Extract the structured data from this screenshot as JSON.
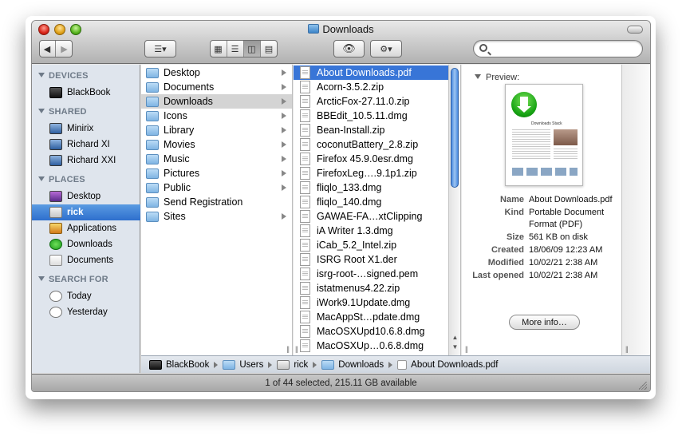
{
  "window": {
    "title": "Downloads"
  },
  "sidebar": {
    "devices_header": "DEVICES",
    "devices": [
      {
        "label": "BlackBook",
        "icon": "laptop-icon"
      }
    ],
    "shared_header": "SHARED",
    "shared": [
      {
        "label": "Minirix",
        "icon": "monitor-icon"
      },
      {
        "label": "Richard XI",
        "icon": "monitor-icon"
      },
      {
        "label": "Richard XXI",
        "icon": "monitor-icon"
      }
    ],
    "places_header": "PLACES",
    "places": [
      {
        "label": "Desktop",
        "icon": "desktop-icon"
      },
      {
        "label": "rick",
        "icon": "home-icon",
        "selected": true
      },
      {
        "label": "Applications",
        "icon": "applications-icon"
      },
      {
        "label": "Downloads",
        "icon": "downloads-icon"
      },
      {
        "label": "Documents",
        "icon": "documents-icon"
      }
    ],
    "search_header": "SEARCH FOR",
    "search_for": [
      {
        "label": "Today",
        "icon": "clock-icon"
      },
      {
        "label": "Yesterday",
        "icon": "clock-icon"
      }
    ]
  },
  "column1": [
    {
      "label": "Desktop",
      "arrow": true
    },
    {
      "label": "Documents",
      "arrow": true
    },
    {
      "label": "Downloads",
      "arrow": true,
      "highlight": true
    },
    {
      "label": "Icons",
      "arrow": true
    },
    {
      "label": "Library",
      "arrow": true
    },
    {
      "label": "Movies",
      "arrow": true
    },
    {
      "label": "Music",
      "arrow": true
    },
    {
      "label": "Pictures",
      "arrow": true
    },
    {
      "label": "Public",
      "arrow": true
    },
    {
      "label": "Send Registration",
      "arrow": false
    },
    {
      "label": "Sites",
      "arrow": true
    }
  ],
  "column2": [
    "About Downloads.pdf",
    "Acorn-3.5.2.zip",
    "ArcticFox-27.11.0.zip",
    "BBEdit_10.5.11.dmg",
    "Bean-Install.zip",
    "coconutBattery_2.8.zip",
    "Firefox 45.9.0esr.dmg",
    "FirefoxLeg….9.1p1.zip",
    "fliqlo_133.dmg",
    "fliqlo_140.dmg",
    "GAWAE-FA…xtClipping",
    "iA Writer 1.3.dmg",
    "iCab_5.2_Intel.zip",
    "ISRG Root X1.der",
    "isrg-root-…signed.pem",
    "istatmenus4.22.zip",
    "iWork9.1Update.dmg",
    "MacAppSt…pdate.dmg",
    "MacOSXUpd10.6.8.dmg",
    "MacOSXUp…0.6.8.dmg"
  ],
  "preview": {
    "header": "Preview:",
    "thumb_title": "Downloads Stack",
    "info": [
      {
        "key": "Name",
        "value": "About Downloads.pdf"
      },
      {
        "key": "Kind",
        "value": "Portable Document Format (PDF)"
      },
      {
        "key": "Size",
        "value": "561 KB on disk"
      },
      {
        "key": "Created",
        "value": "18/06/09 12:23 AM"
      },
      {
        "key": "Modified",
        "value": "10/02/21 2:38 AM"
      },
      {
        "key": "Last opened",
        "value": "10/02/21 2:38 AM"
      }
    ],
    "more_info_label": "More info…"
  },
  "pathbar": [
    "BlackBook",
    "Users",
    "rick",
    "Downloads",
    "About Downloads.pdf"
  ],
  "status": "1 of 44 selected, 215.11 GB available",
  "colors": {
    "selection": "#3875d7",
    "sidebar_bg": "#dfe5ed",
    "sidebar_selected": "#2e6fcd"
  }
}
